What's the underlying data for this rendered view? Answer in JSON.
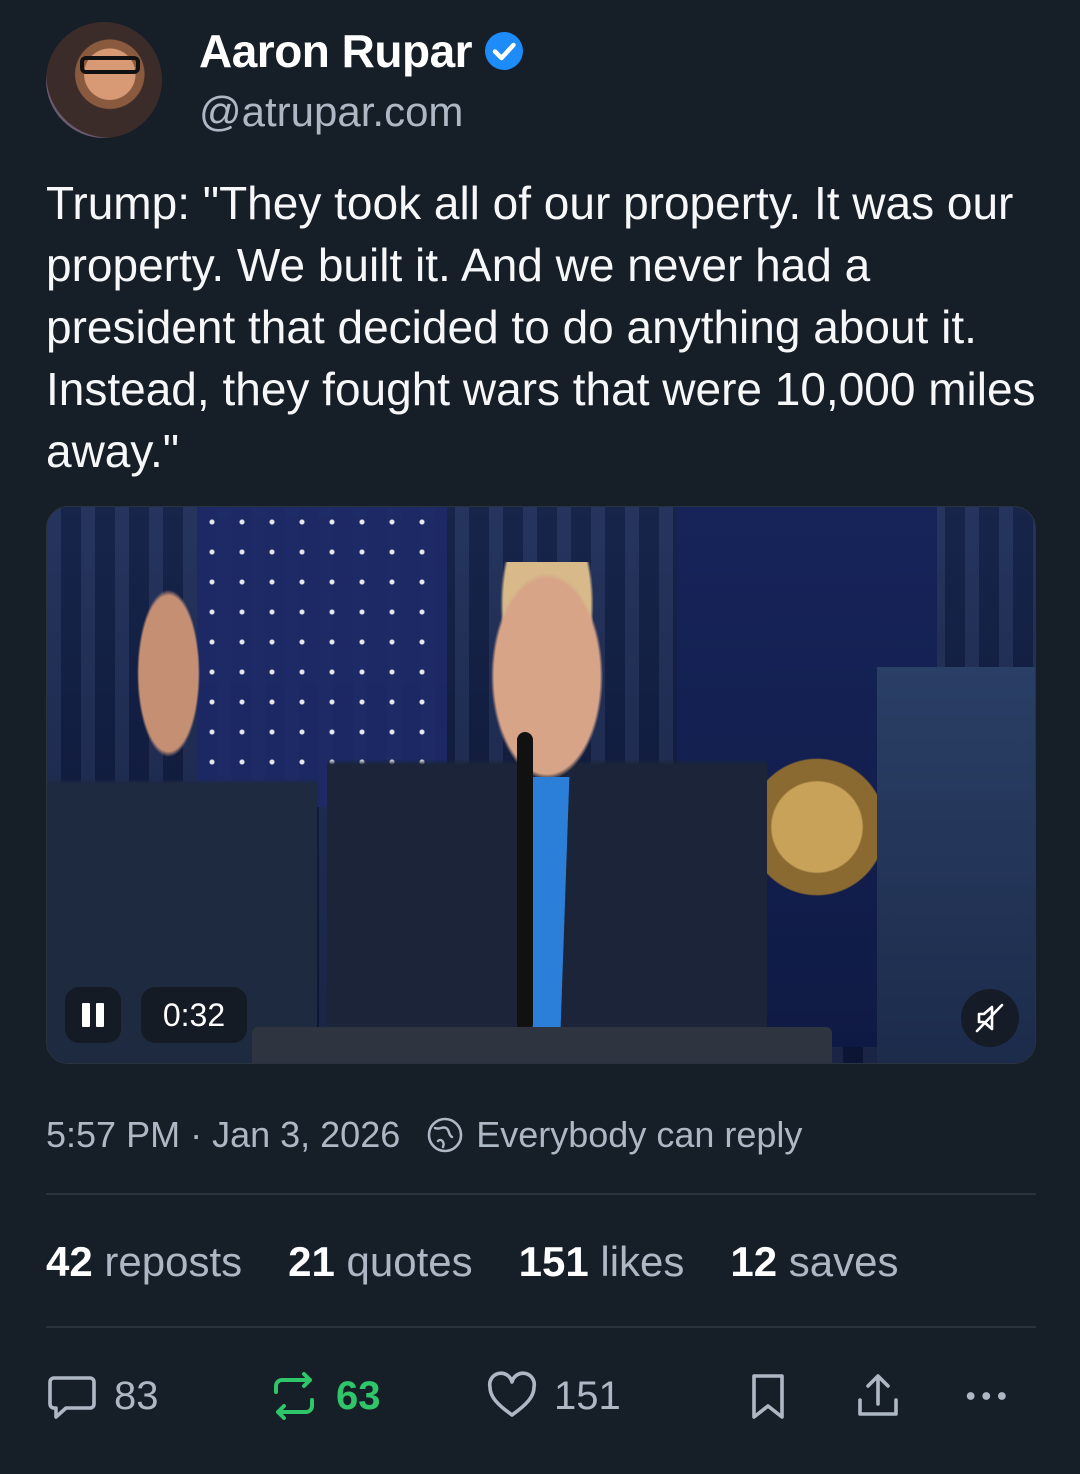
{
  "author": {
    "display_name": "Aaron Rupar",
    "handle": "@atrupar.com",
    "verified": true
  },
  "post": {
    "text": "Trump: \"They took all of our property. It was our property. We built it. And we never had a president that decided to do anything about it. Instead, they fought wars that were 10,000 miles away.\""
  },
  "video": {
    "time": "0:32",
    "state": "playing",
    "muted": true
  },
  "meta": {
    "time": "5:57 PM",
    "separator": "·",
    "date": "Jan 3, 2026",
    "reply_setting": "Everybody can reply"
  },
  "stats": {
    "reposts": {
      "count": "42",
      "label": "reposts"
    },
    "quotes": {
      "count": "21",
      "label": "quotes"
    },
    "likes": {
      "count": "151",
      "label": "likes"
    },
    "saves": {
      "count": "12",
      "label": "saves"
    }
  },
  "actions": {
    "replies": "83",
    "reposts": "63",
    "likes": "151"
  },
  "colors": {
    "background": "#161e27",
    "verified": "#1d8cf8",
    "repost_active": "#2fc66a",
    "muted_text": "#aeb8c4"
  }
}
